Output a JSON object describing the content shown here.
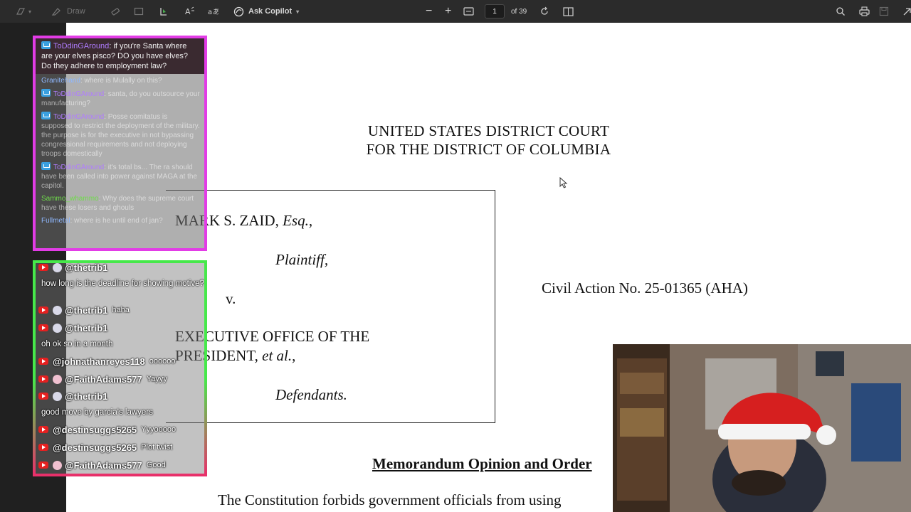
{
  "toolbar": {
    "draw_label": "Draw",
    "copilot_label": "Ask Copilot",
    "page_current": "1",
    "page_total_label": "of 39"
  },
  "document": {
    "court_line1": "UNITED STATES DISTRICT COURT",
    "court_line2": "FOR THE DISTRICT OF COLUMBIA",
    "plaintiff_name": "MARK S. ZAID,",
    "plaintiff_suffix": "Esq.",
    "plaintiff_suffix_comma": ",",
    "plaintiff_role": "Plaintiff,",
    "versus": "v.",
    "defendant_line1": "EXECUTIVE OFFICE OF THE",
    "defendant_line2": "PRESIDENT,",
    "defendant_suffix": "et al.",
    "defendant_suffix_comma": ",",
    "defendant_role": "Defendants.",
    "civil_action": "Civil Action No. 25-01365 (AHA)",
    "memo_title": "Memorandum Opinion and Order",
    "body_line": "The Constitution forbids government officials from using"
  },
  "chat_overlay_1": {
    "pinned": {
      "username": "ToDdinGAround",
      "message": "if you're Santa where are your elves pisco? DO you have elves? Do they adhere to employment law?"
    },
    "messages": [
      {
        "username": "Granitehand",
        "message": "where is Mulally on this?"
      },
      {
        "username": "ToDdinGAround",
        "message": "santa, do you outsource your manufacturing?"
      },
      {
        "username": "ToDdinGAround",
        "message": "Posse comitatus is supposed to restrict the deployment of the military. the purpose is for the executive in not bypassing congressional requirements and not deploying troops domestically"
      },
      {
        "username": "ToDdinGAround",
        "message": "it's total bs... The ra should have been called into power against MAGA at the capitol."
      },
      {
        "username": "Sammo_whammo",
        "message": "Why does the supreme court have these losers and ghouls"
      },
      {
        "username": "Fullmetal",
        "message": "where is he until end of jan?"
      }
    ]
  },
  "chat_overlay_2": {
    "top_handle": "@thetrib1",
    "top_message": "how long is the deadline for showing motive?",
    "rows": [
      {
        "handle": "@thetrib1",
        "message": "haha"
      },
      {
        "handle": "@thetrib1",
        "message": ""
      }
    ],
    "text_line_1": "oh ok so in a month",
    "rows2": [
      {
        "handle": "@johnathanreyes118",
        "message": "oooooo"
      },
      {
        "handle": "@FaithAdams577",
        "message": "Yayyy"
      },
      {
        "handle": "@thetrib1",
        "message": ""
      }
    ],
    "text_line_2": "good move by garcia's lawyers",
    "rows3": [
      {
        "handle": "@destinsuggs5265",
        "message": "Yyyooooo"
      },
      {
        "handle": "@destinsuggs5265",
        "message": "Plot twist"
      },
      {
        "handle": "@FaithAdams577",
        "message": "Good"
      }
    ]
  },
  "colors": {
    "chat1_border": "#e23ce6",
    "chat2_border_top": "#46e84a",
    "chat2_border_bottom": "#e8306a",
    "toolbar_bg": "#2b2b2b",
    "doc_bg": "#ffffff"
  }
}
